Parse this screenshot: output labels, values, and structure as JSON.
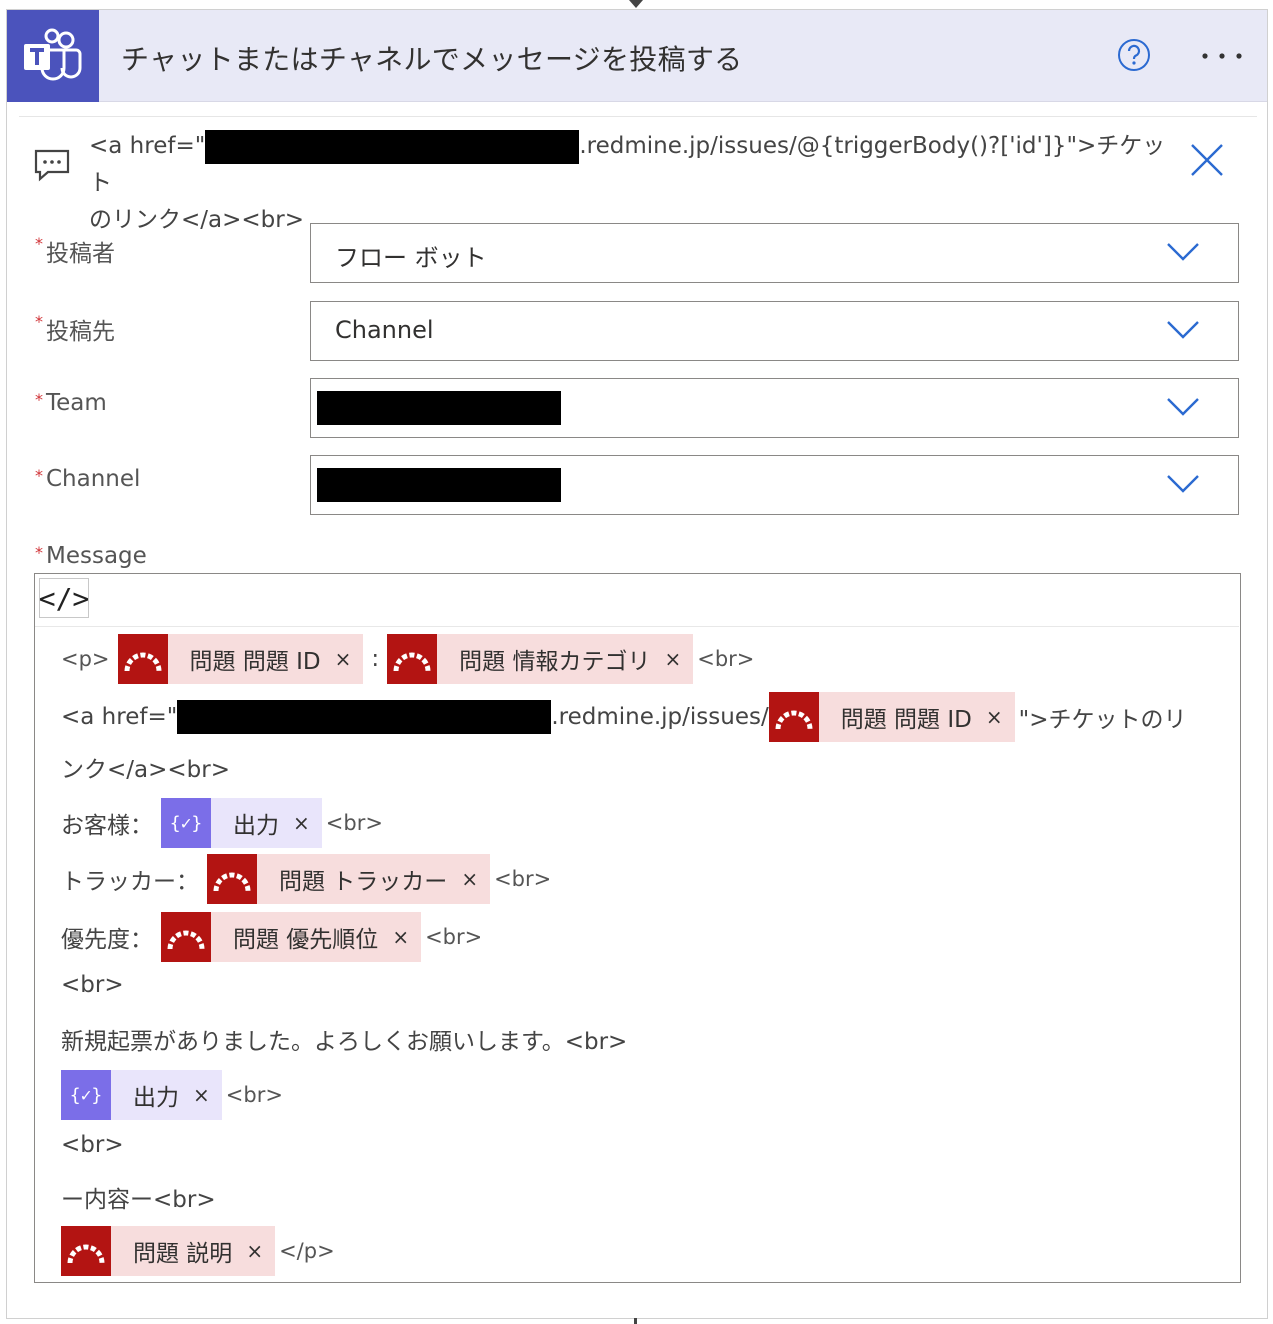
{
  "header": {
    "title": "チャットまたはチャネルでメッセージを投稿する"
  },
  "comment": {
    "prefix": "<a href=\"",
    "suffix": ".redmine.jp/issues/@{triggerBody()?['id']}\">チケット",
    "line2": "のリンク</a><br>"
  },
  "fields": [
    {
      "label": "投稿者",
      "value": "フロー ボット"
    },
    {
      "label": "投稿先",
      "value": "Channel"
    },
    {
      "label": "Team",
      "value": ""
    },
    {
      "label": "Channel",
      "value": ""
    }
  ],
  "message": {
    "label": "Message",
    "code_toggle": "</>",
    "line1": {
      "start": "<p>",
      "token1": "問題 問題 ID",
      "colon": ":",
      "token2": "問題 情報カテゴリ",
      "end": "<br>"
    },
    "line2": {
      "start": "<a href=\"",
      "mid": ".redmine.jp/issues/",
      "token": "問題 問題 ID",
      "end": "\">チケットのリ"
    },
    "line3": {
      "text": "ンク</a><br>"
    },
    "line4": {
      "start": "お客様：",
      "token": "出力",
      "end": "<br>"
    },
    "line5": {
      "start": "トラッカー：",
      "token": "問題 トラッカー",
      "end": "<br>"
    },
    "line6": {
      "start": "優先度：",
      "token": "問題 優先順位",
      "end": "<br>"
    },
    "line7": {
      "text": "<br>"
    },
    "line8": {
      "text": "新規起票がありました。よろしくお願いします。<br>"
    },
    "line9": {
      "token": "出力",
      "end": "<br>"
    },
    "line10": {
      "text": "<br>"
    },
    "line11": {
      "text": "ー内容ー<br>"
    },
    "line12": {
      "token": "問題 説明",
      "end": "</p>"
    },
    "remove_symbol": "×"
  }
}
